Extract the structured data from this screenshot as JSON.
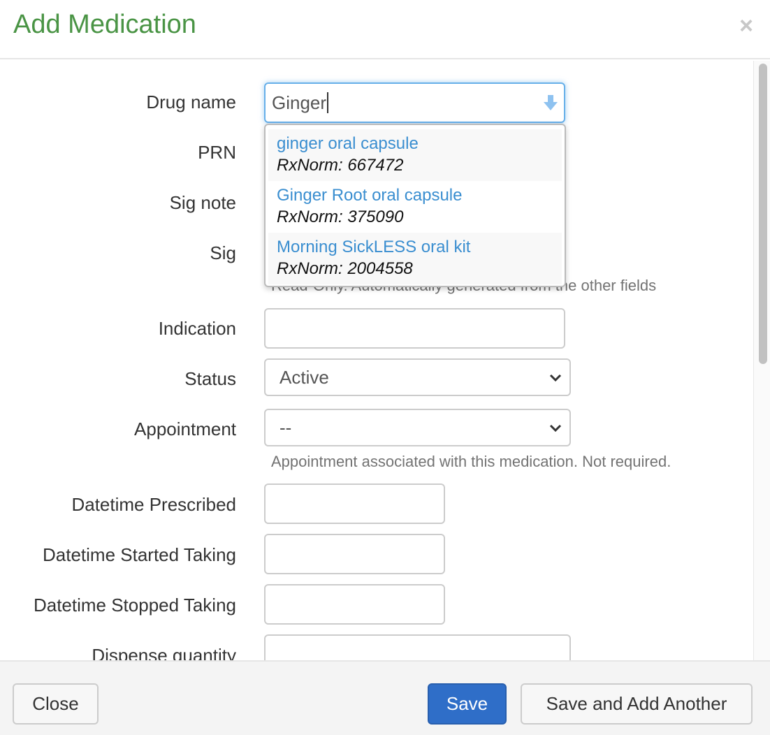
{
  "header": {
    "title": "Add Medication",
    "close_icon": "close-icon"
  },
  "form": {
    "drug_name": {
      "label": "Drug name",
      "value": "Ginger",
      "icon": "arrow-down-icon"
    },
    "prn": {
      "label": "PRN"
    },
    "sig_note": {
      "label": "Sig note"
    },
    "sig": {
      "label": "Sig",
      "help": "Read-Only. Automatically generated from the other fields"
    },
    "indication": {
      "label": "Indication",
      "value": ""
    },
    "status": {
      "label": "Status",
      "value": "Active"
    },
    "appointment": {
      "label": "Appointment",
      "value": "--",
      "help": "Appointment associated with this medication. Not required."
    },
    "datetime_prescribed": {
      "label": "Datetime Prescribed",
      "value": ""
    },
    "datetime_started": {
      "label": "Datetime Started Taking",
      "value": ""
    },
    "datetime_stopped": {
      "label": "Datetime Stopped Taking",
      "value": ""
    },
    "dispense_quantity": {
      "label": "Dispense quantity",
      "value": ""
    }
  },
  "suggestions": [
    {
      "name": "ginger oral capsule",
      "code": "RxNorm: 667472"
    },
    {
      "name": "Ginger Root oral capsule",
      "code": "RxNorm: 375090"
    },
    {
      "name": "Morning SickLESS oral kit",
      "code": "RxNorm: 2004558"
    }
  ],
  "footer": {
    "close": "Close",
    "save": "Save",
    "save_another": "Save and Add Another"
  },
  "colors": {
    "title": "#4a9445",
    "primary": "#2f6ec8",
    "link": "#3a8ed0"
  }
}
